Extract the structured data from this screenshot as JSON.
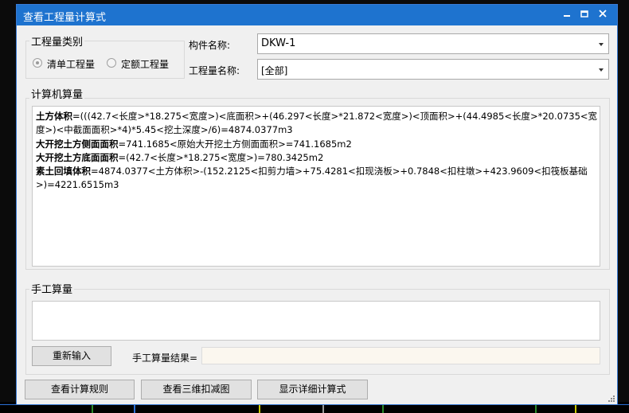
{
  "window": {
    "title": "查看工程量计算式",
    "minimize_icon": "minimize-icon",
    "maximize_icon": "maximize-icon",
    "close_icon": "close-icon"
  },
  "qty_category": {
    "title": "工程量类别",
    "options": [
      {
        "label": "清单工程量",
        "selected": true
      },
      {
        "label": "定额工程量",
        "selected": false
      }
    ]
  },
  "component_name": {
    "label": "构件名称:",
    "value": "DKW-1"
  },
  "qty_name": {
    "label": "工程量名称:",
    "value": "[全部]"
  },
  "computer_calc": {
    "title": "计算机算量",
    "lines": [
      {
        "name": "土方体积",
        "formula": "=(((42.7<长度>*18.275<宽度>)<底面积>+(46.297<长度>*21.872<宽度>)<顶面积>+(44.4985<长度>*20.0735<宽度>)<中截面面积>*4)*5.45<挖土深度>/6)=4874.0377m3"
      },
      {
        "name": "大开挖土方侧面面积",
        "formula": "=741.1685<原始大开挖土方侧面面积>=741.1685m2"
      },
      {
        "name": "大开挖土方底面面积",
        "formula": "=(42.7<长度>*18.275<宽度>)=780.3425m2"
      },
      {
        "name": "素土回填体积",
        "formula": "=4874.0377<土方体积>-(152.2125<扣剪力墙>+75.4281<扣现浇板>+0.7848<扣柱墩>+423.9609<扣筏板基础>)=4221.6515m3"
      }
    ]
  },
  "manual_calc": {
    "title": "手工算量",
    "input_value": "",
    "reenter_button": "重新输入",
    "result_label": "手工算量结果=",
    "result_value": ""
  },
  "footer_buttons": {
    "view_rules": "查看计算规则",
    "view_3d": "查看三维扣减图",
    "show_detail": "显示详细计算式"
  },
  "colors": {
    "titlebar": "#1e73cf",
    "dialog_bg": "#f0f0f0",
    "result_bg": "#fbf7ef"
  }
}
